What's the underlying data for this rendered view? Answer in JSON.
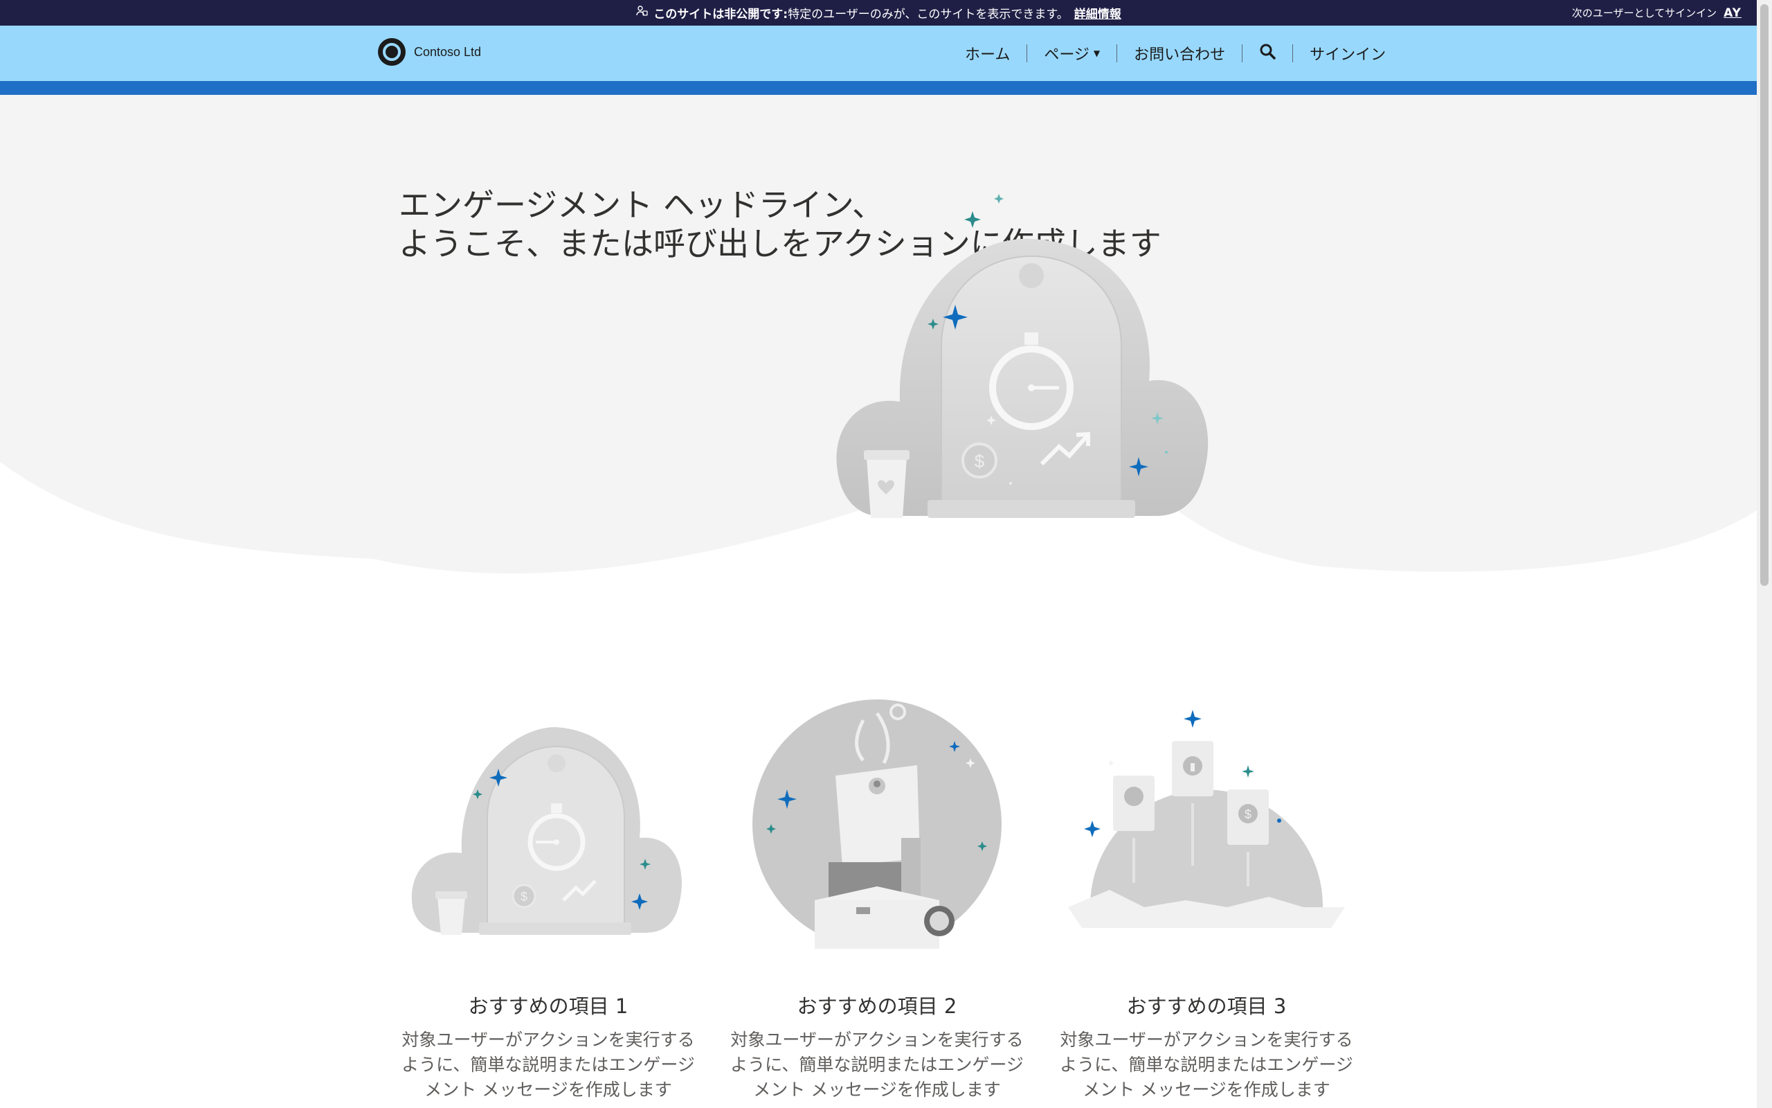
{
  "banner": {
    "bold_text": "このサイトは非公開です:",
    "text": "特定のユーザーのみが、このサイトを表示できます。",
    "link": "詳細情報",
    "signin_as": "次のユーザーとしてサインイン",
    "initials": "AY"
  },
  "header": {
    "logo_text": "Contoso Ltd",
    "nav": {
      "home": "ホーム",
      "pages": "ページ",
      "contact": "お問い合わせ",
      "signin": "サインイン"
    }
  },
  "hero": {
    "title_line1": "エンゲージメント ヘッドライン、",
    "title_line2": "ようこそ、または呼び出しをアクションに作成します"
  },
  "cards": [
    {
      "title": "おすすめの項目 1",
      "desc_line1": "対象ユーザーがアクションを実行する",
      "desc_line2": "ように、簡単な説明またはエンゲージ",
      "desc_line3": "メント メッセージを作成します"
    },
    {
      "title": "おすすめの項目 2",
      "desc_line1": "対象ユーザーがアクションを実行する",
      "desc_line2": "ように、簡単な説明またはエンゲージ",
      "desc_line3": "メント メッセージを作成します"
    },
    {
      "title": "おすすめの項目 3",
      "desc_line1": "対象ユーザーがアクションを実行する",
      "desc_line2": "ように、簡単な説明またはエンゲージ",
      "desc_line3": "メント メッセージを作成します"
    }
  ],
  "colors": {
    "banner_bg": "#1f1f46",
    "header_bg": "#98d8fc",
    "header_stripe": "#1f6fc6",
    "hero_bg": "#f3f4f3",
    "accent_teal": "#2c8c8c",
    "accent_blue": "#0f6cbd"
  }
}
